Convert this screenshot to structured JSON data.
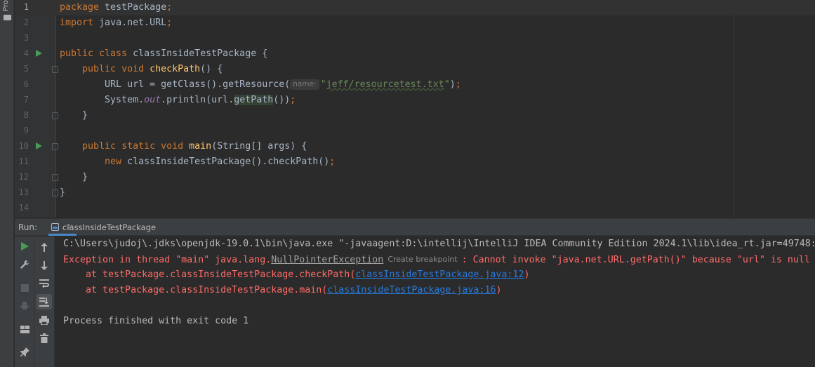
{
  "project_strip": {
    "label": "Pro"
  },
  "editor": {
    "lines": [
      {
        "n": "1"
      },
      {
        "n": "2"
      },
      {
        "n": "3"
      },
      {
        "n": "4"
      },
      {
        "n": "5"
      },
      {
        "n": "6"
      },
      {
        "n": "7"
      },
      {
        "n": "8"
      },
      {
        "n": "9"
      },
      {
        "n": "10"
      },
      {
        "n": "11"
      },
      {
        "n": "12"
      },
      {
        "n": "13"
      },
      {
        "n": "14"
      }
    ],
    "t": {
      "l1_kw": "package",
      "l1_rest": " testPackage",
      "semi": ";",
      "l2_kw": "import",
      "l2_rest": " java.net.URL",
      "l4_kw": "public class",
      "l4_name": " classInsideTestPackage ",
      "l4_brace": "{",
      "l5_kw": "public void",
      "l5_fn": "checkPath",
      "l5_rest": "() {",
      "l6_a": "URL url = getClass().getResource(",
      "l6_hint": "name:",
      "l6_str_q1": "\"",
      "l6_str_path": "jeff/resourcetest.txt",
      "l6_str_q2": "\"",
      "l6_close": ")",
      "l7_a": "System.",
      "l7_out": "out",
      "l7_b": ".println(url.",
      "l7_getpath": "getPath",
      "l7_c": "())",
      "close_brace": "}",
      "l10_kw": "public static void",
      "l10_fn": "main",
      "l10_rest": "(String[] args) {",
      "l11_kw": "new",
      "l11_rest": " classInsideTestPackage().checkPath()"
    }
  },
  "run_panel": {
    "label": "Run:",
    "tab_label": "classInsideTestPackage",
    "tab_close": "×"
  },
  "console": {
    "cmd": "C:\\Users\\judoj\\.jdks\\openjdk-19.0.1\\bin\\java.exe \"-javaagent:D:\\intellij\\IntelliJ IDEA Community Edition 2024.1\\lib\\idea_rt.jar=49748:",
    "exc_prefix": "Exception in thread \"main\" java.lang.",
    "exc_class": "NullPointerException",
    "create_bp": "Create breakpoint",
    "exc_msg": ": Cannot invoke \"java.net.URL.getPath()\" because \"url\" is null",
    "st1_prefix": "    at testPackage.classInsideTestPackage.checkPath(",
    "st1_link": "classInsideTestPackage.java:12",
    "st2_prefix": "    at testPackage.classInsideTestPackage.main(",
    "st2_link": "classInsideTestPackage.java:16",
    "paren": ")",
    "finished": "Process finished with exit code 1"
  }
}
